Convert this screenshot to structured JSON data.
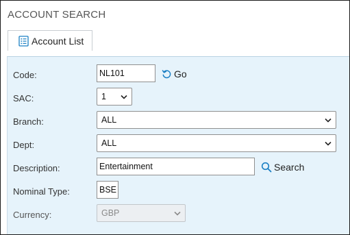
{
  "page": {
    "title": "ACCOUNT SEARCH"
  },
  "tab": {
    "label": "Account List"
  },
  "form": {
    "code": {
      "label": "Code:",
      "value": "NL101"
    },
    "go_label": "Go",
    "sac": {
      "label": "SAC:",
      "value": "1"
    },
    "branch": {
      "label": "Branch:",
      "value": "ALL"
    },
    "dept": {
      "label": "Dept:",
      "value": "ALL"
    },
    "description": {
      "label": "Description:",
      "value": "Entertainment"
    },
    "search_label": "Search",
    "nominal_type": {
      "label": "Nominal Type:",
      "value": "BSE"
    },
    "currency": {
      "label": "Currency:",
      "value": "GBP"
    }
  },
  "colors": {
    "accent": "#1a7fc4",
    "panel_bg": "#e6f3fb"
  }
}
